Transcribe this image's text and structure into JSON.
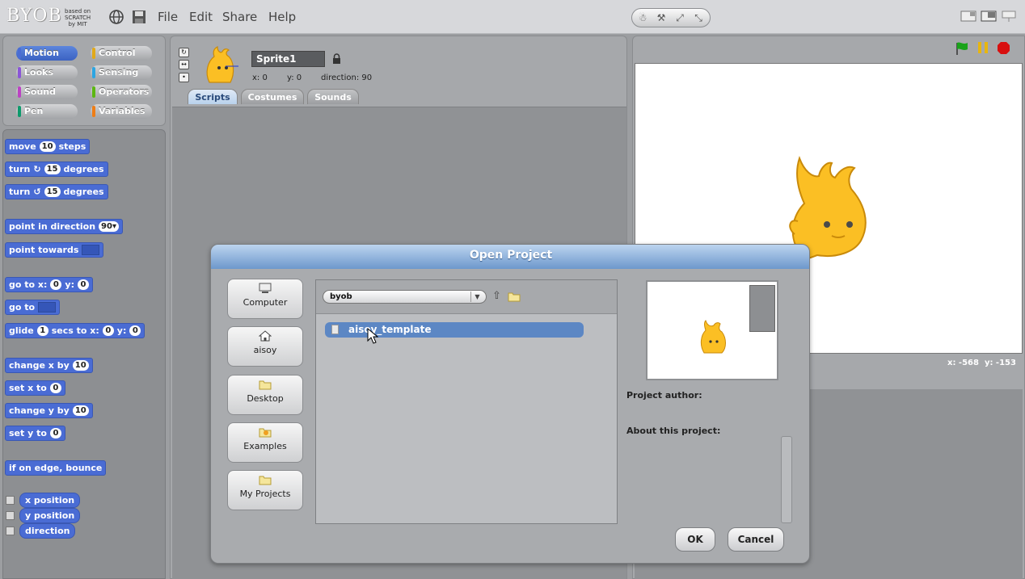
{
  "topbar": {
    "logo": "BYOB",
    "logo_sub": [
      "based on",
      "SCRATCH",
      "by MIT"
    ],
    "menus": [
      "File",
      "Edit",
      "Share",
      "Help"
    ],
    "globe_icon": "globe-icon",
    "save_icon": "floppy-disk-icon"
  },
  "categories": {
    "motion": "Motion",
    "looks": "Looks",
    "sound": "Sound",
    "pen": "Pen",
    "control": "Control",
    "sensing": "Sensing",
    "operators": "Operators",
    "variables": "Variables"
  },
  "category_colors": {
    "motion": "#4a6cd4",
    "looks": "#8a55d7",
    "sound": "#bb42c3",
    "pen": "#0e9a6c",
    "control": "#e1a91a",
    "sensing": "#2ca5e2",
    "operators": "#5cb712",
    "variables": "#ee7d16"
  },
  "blocks": {
    "move": {
      "pre": "move",
      "val": "10",
      "post": "steps"
    },
    "turn_cw": {
      "pre": "turn",
      "val": "15",
      "post": "degrees"
    },
    "turn_ccw": {
      "pre": "turn",
      "val": "15",
      "post": "degrees"
    },
    "point_dir": {
      "pre": "point in direction",
      "val": "90"
    },
    "point_towards": {
      "pre": "point towards"
    },
    "go_to_xy": {
      "pre": "go to x:",
      "x": "0",
      "mid": "y:",
      "y": "0"
    },
    "go_to": {
      "pre": "go to"
    },
    "glide": {
      "pre": "glide",
      "secs": "1",
      "mid1": "secs to x:",
      "x": "0",
      "mid2": "y:",
      "y": "0"
    },
    "change_x": {
      "pre": "change x by",
      "val": "10"
    },
    "set_x": {
      "pre": "set x to",
      "val": "0"
    },
    "change_y": {
      "pre": "change y by",
      "val": "10"
    },
    "set_y": {
      "pre": "set y to",
      "val": "0"
    },
    "bounce": {
      "pre": "if on edge, bounce"
    },
    "x_position": "x position",
    "y_position": "y position",
    "direction": "direction"
  },
  "sprite": {
    "name": "Sprite1",
    "x_label": "x: 0",
    "y_label": "y: 0",
    "direction_label": "direction: 90"
  },
  "tabs": [
    "Scripts",
    "Costumes",
    "Sounds"
  ],
  "stage": {
    "mouse_x": "x: -568",
    "mouse_y": "y: -153",
    "accent_green": "#1aa31a",
    "accent_pause": "#e8b60f",
    "accent_stop": "#d80f0f"
  },
  "dialog": {
    "title": "Open Project",
    "locations": [
      "Computer",
      "aisoy",
      "Desktop",
      "Examples",
      "My Projects"
    ],
    "folder": "byob",
    "files": [
      "aisoy_template"
    ],
    "author_label": "Project author:",
    "about_label": "About this project:",
    "ok": "OK",
    "cancel": "Cancel"
  }
}
